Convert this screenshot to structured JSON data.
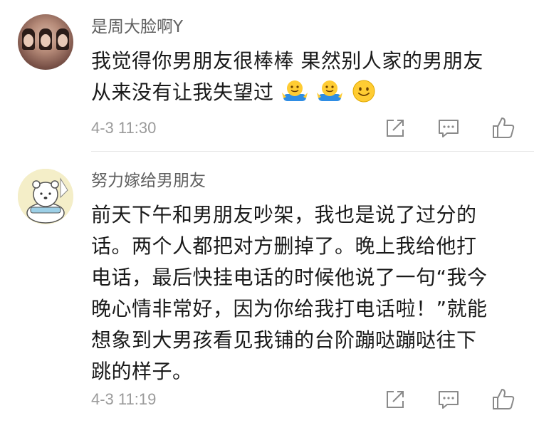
{
  "comments": [
    {
      "username": "是周大脸啊Y",
      "text_line1": "我觉得你男朋友很棒棒 果然别人家的男朋友",
      "text_line2": "从来没有让我失望过",
      "emojis": [
        "shrug-emoji",
        "shrug-emoji",
        "smile-emoji"
      ],
      "timestamp": "4-3 11:30",
      "actions": [
        "share-icon",
        "reply-icon",
        "like-icon"
      ]
    },
    {
      "username": "努力嫁给男朋友",
      "text_lines": [
        "前天下午和男朋友吵架，我也是说了过分的",
        "话。两个人都把对方删掉了。晚上我给他打",
        "电话，最后快挂电话的时候他说了一句“我今",
        "晚心情非常好，因为你给我打电话啦！”就能",
        "想象到大男孩看见我铺的台阶蹦哒蹦哒往下",
        "跳的样子。"
      ],
      "timestamp": "4-3 11:19",
      "actions": [
        "share-icon",
        "reply-icon",
        "like-icon"
      ]
    }
  ],
  "colors": {
    "username": "#606060",
    "body": "#1a1a1a",
    "meta": "#9a9a9a",
    "icon": "#8a8a8a",
    "divider": "#e6e6e6",
    "emoji_yellow": "#ffcc33",
    "emoji_blue": "#2f8de4"
  }
}
